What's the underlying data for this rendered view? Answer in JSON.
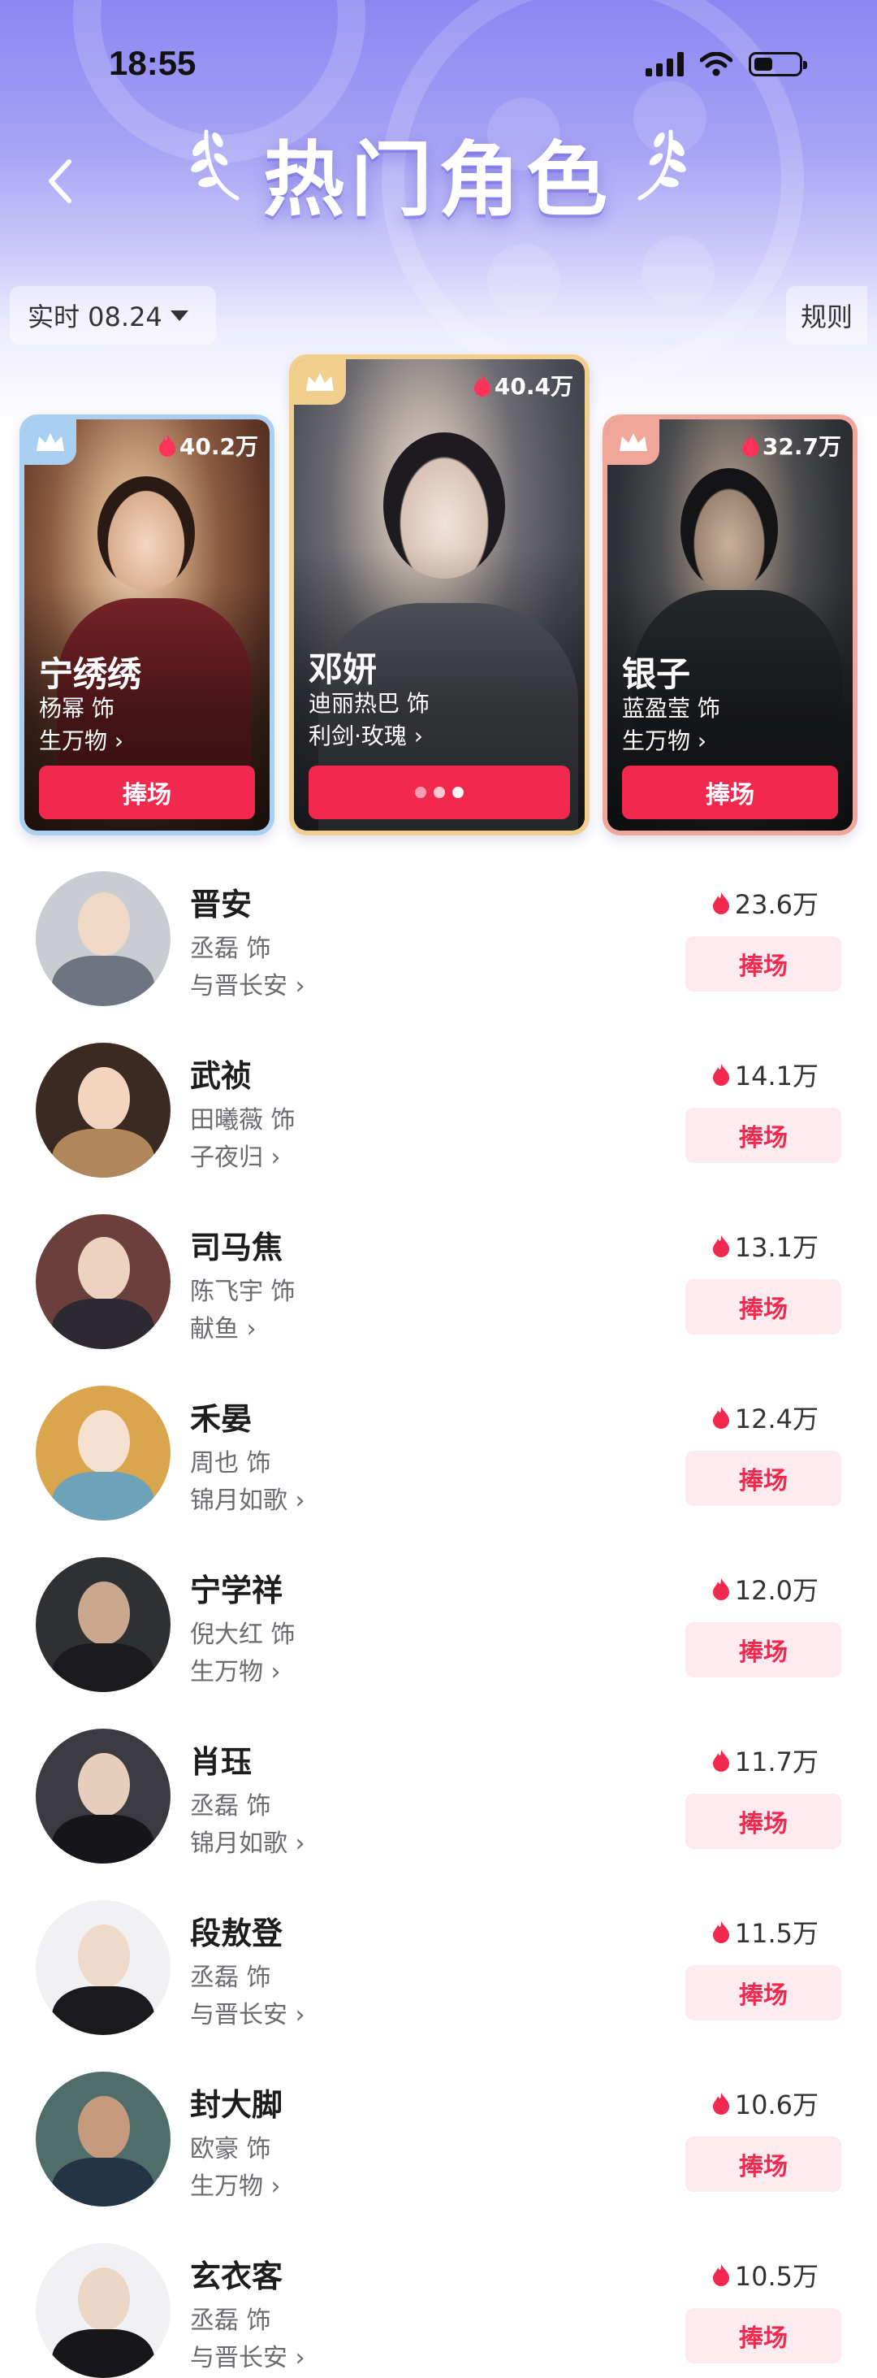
{
  "status_bar": {
    "time": "18:55"
  },
  "header": {
    "title": "热门角色"
  },
  "filter": {
    "date_label": "实时 08.24",
    "rules_label": "规则"
  },
  "podium": [
    {
      "rank": 2,
      "name": "宁绣绣",
      "actor": "杨幂 饰",
      "show": "生万物 ›",
      "heat": "40.2万",
      "button": "捧场",
      "border_color": "#a9d0f2"
    },
    {
      "rank": 1,
      "name": "邓妍",
      "actor": "迪丽热巴 饰",
      "show": "利剑·玫瑰 ›",
      "heat": "40.4万",
      "button": "",
      "border_color": "#f3cf8e"
    },
    {
      "rank": 3,
      "name": "银子",
      "actor": "蓝盈莹 饰",
      "show": "生万物 ›",
      "heat": "32.7万",
      "button": "捧场",
      "border_color": "#f0a79a"
    }
  ],
  "list": [
    {
      "name": "晋安",
      "actor": "丞磊 饰",
      "show": "与晋长安 ›",
      "heat": "23.6万",
      "button": "捧场"
    },
    {
      "name": "武祯",
      "actor": "田曦薇 饰",
      "show": "子夜归 ›",
      "heat": "14.1万",
      "button": "捧场"
    },
    {
      "name": "司马焦",
      "actor": "陈飞宇 饰",
      "show": "献鱼 ›",
      "heat": "13.1万",
      "button": "捧场"
    },
    {
      "name": "禾晏",
      "actor": "周也 饰",
      "show": "锦月如歌 ›",
      "heat": "12.4万",
      "button": "捧场"
    },
    {
      "name": "宁学祥",
      "actor": "倪大红 饰",
      "show": "生万物 ›",
      "heat": "12.0万",
      "button": "捧场"
    },
    {
      "name": "肖珏",
      "actor": "丞磊 饰",
      "show": "锦月如歌 ›",
      "heat": "11.7万",
      "button": "捧场"
    },
    {
      "name": "段敖登",
      "actor": "丞磊 饰",
      "show": "与晋长安 ›",
      "heat": "11.5万",
      "button": "捧场"
    },
    {
      "name": "封大脚",
      "actor": "欧豪 饰",
      "show": "生万物 ›",
      "heat": "10.6万",
      "button": "捧场"
    },
    {
      "name": "玄衣客",
      "actor": "丞磊 饰",
      "show": "与晋长安 ›",
      "heat": "10.5万",
      "button": "捧场"
    }
  ],
  "colors": {
    "accent": "#f2294f",
    "button_soft_bg": "#fdebef",
    "header_purple": "#8c86f2"
  }
}
